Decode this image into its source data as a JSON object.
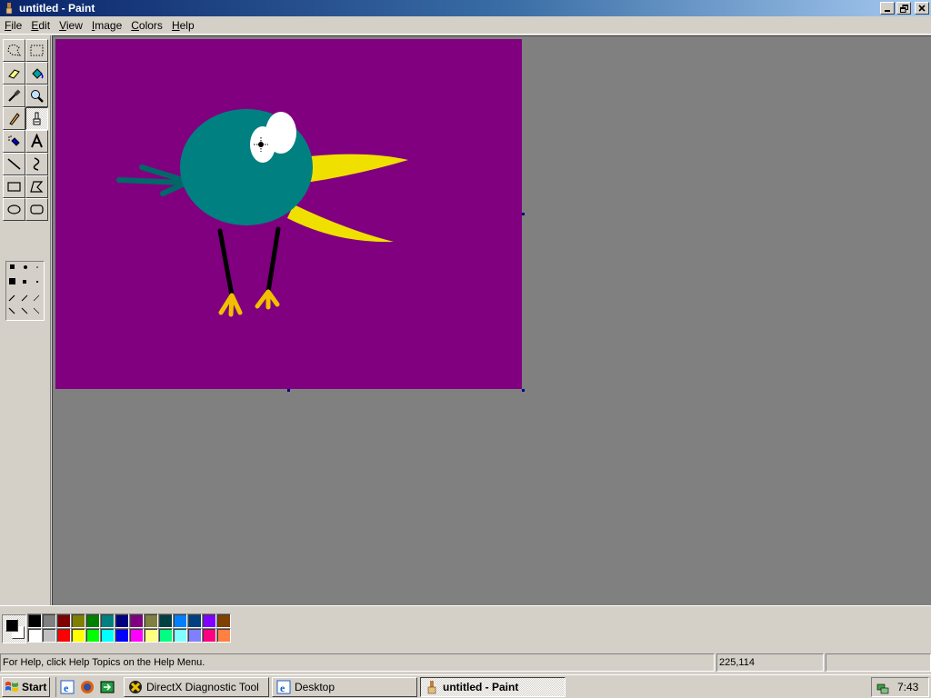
{
  "window": {
    "title": "untitled - Paint",
    "icon": "paint-app-icon",
    "minimize_icon": "minimize-icon",
    "restore_icon": "restore-icon",
    "close_icon": "close-icon"
  },
  "menu": {
    "items": [
      {
        "label": "File",
        "accel": "F",
        "rest": "ile"
      },
      {
        "label": "Edit",
        "accel": "E",
        "rest": "dit"
      },
      {
        "label": "View",
        "accel": "V",
        "rest": "iew"
      },
      {
        "label": "Image",
        "accel": "I",
        "rest": "mage"
      },
      {
        "label": "Colors",
        "accel": "C",
        "rest": "olors"
      },
      {
        "label": "Help",
        "accel": "H",
        "rest": "elp"
      }
    ]
  },
  "tools": [
    {
      "name": "free-form-select",
      "icon": "free-form-select-icon"
    },
    {
      "name": "select",
      "icon": "rectangle-select-icon"
    },
    {
      "name": "eraser",
      "icon": "eraser-icon"
    },
    {
      "name": "fill-with-color",
      "icon": "paint-bucket-icon"
    },
    {
      "name": "pick-color",
      "icon": "eyedropper-icon"
    },
    {
      "name": "magnifier",
      "icon": "magnifier-icon"
    },
    {
      "name": "pencil",
      "icon": "pencil-icon"
    },
    {
      "name": "brush",
      "icon": "brush-icon",
      "active": true
    },
    {
      "name": "airbrush",
      "icon": "airbrush-icon"
    },
    {
      "name": "text",
      "icon": "text-icon"
    },
    {
      "name": "line",
      "icon": "line-icon"
    },
    {
      "name": "curve",
      "icon": "curve-icon"
    },
    {
      "name": "rectangle",
      "icon": "rectangle-icon"
    },
    {
      "name": "polygon",
      "icon": "polygon-icon"
    },
    {
      "name": "ellipse",
      "icon": "ellipse-icon"
    },
    {
      "name": "rounded-rectangle",
      "icon": "rounded-rectangle-icon"
    }
  ],
  "tool_options": {
    "selected": "brush-round-large"
  },
  "canvas": {
    "background": "#800080",
    "bird_body": "#008080",
    "beak": "#f0e000",
    "eye": "#ffffff",
    "legs": "#000000",
    "feet": "#f0c000"
  },
  "colors": {
    "foreground": "#000000",
    "background": "#ffffff",
    "palette": [
      "#000000",
      "#808080",
      "#800000",
      "#808000",
      "#008000",
      "#008080",
      "#000080",
      "#800080",
      "#808040",
      "#004040",
      "#0080ff",
      "#004080",
      "#8000ff",
      "#804000",
      "#ffffff",
      "#c0c0c0",
      "#ff0000",
      "#ffff00",
      "#00ff00",
      "#00ffff",
      "#0000ff",
      "#ff00ff",
      "#ffff80",
      "#00ff80",
      "#80ffff",
      "#8080ff",
      "#ff0080",
      "#ff8040"
    ]
  },
  "status": {
    "help_text": "For Help, click Help Topics on the Help Menu.",
    "coordinates": "225,114",
    "size": ""
  },
  "taskbar": {
    "start_label": "Start",
    "quick_launch": [
      "ie-icon",
      "firefox-icon",
      "show-desktop-icon"
    ],
    "tasks": [
      {
        "label": "DirectX Diagnostic Tool",
        "icon": "directx-icon",
        "active": false
      },
      {
        "label": "Desktop",
        "icon": "desktop-folder-icon",
        "active": false
      },
      {
        "label": "untitled - Paint",
        "icon": "paint-app-icon",
        "active": true
      }
    ],
    "tray_icon": "network-icon",
    "clock": "7:43"
  }
}
